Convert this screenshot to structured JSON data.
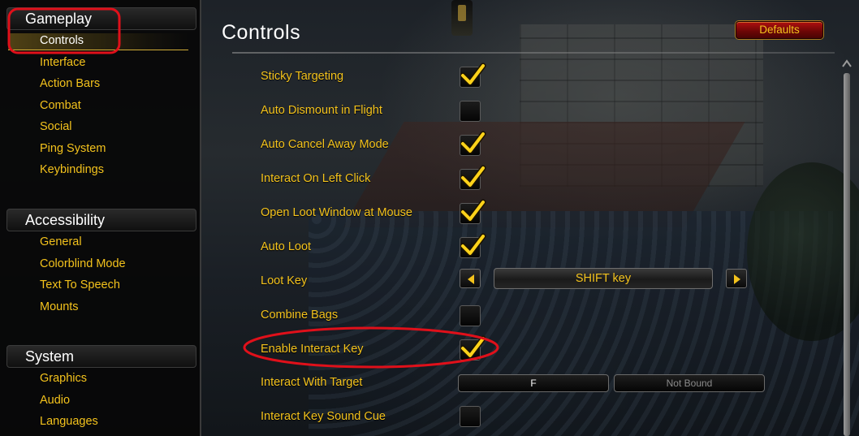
{
  "sidebar": {
    "sections": [
      {
        "title": "Gameplay",
        "items": [
          "Controls",
          "Interface",
          "Action Bars",
          "Combat",
          "Social",
          "Ping System",
          "Keybindings"
        ],
        "selected": "Controls"
      },
      {
        "title": "Accessibility",
        "items": [
          "General",
          "Colorblind Mode",
          "Text To Speech",
          "Mounts"
        ]
      },
      {
        "title": "System",
        "items": [
          "Graphics",
          "Audio",
          "Languages"
        ]
      }
    ]
  },
  "panel": {
    "title": "Controls",
    "defaults_label": "Defaults"
  },
  "settings": [
    {
      "label": "Sticky Targeting",
      "type": "checkbox",
      "checked": true
    },
    {
      "label": "Auto Dismount in Flight",
      "type": "checkbox",
      "checked": false
    },
    {
      "label": "Auto Cancel Away Mode",
      "type": "checkbox",
      "checked": true
    },
    {
      "label": "Interact On Left Click",
      "type": "checkbox",
      "checked": true
    },
    {
      "label": "Open Loot Window at Mouse",
      "type": "checkbox",
      "checked": true
    },
    {
      "label": "Auto Loot",
      "type": "checkbox",
      "checked": true
    },
    {
      "label": "Loot Key",
      "type": "dropdown",
      "value": "SHIFT key"
    },
    {
      "label": "Combine Bags",
      "type": "checkbox",
      "checked": false
    },
    {
      "label": "Enable Interact Key",
      "type": "checkbox",
      "checked": true
    },
    {
      "label": "Interact With Target",
      "type": "keybind",
      "binding_primary": "F",
      "binding_secondary": "Not Bound"
    },
    {
      "label": "Interact Key Sound Cue",
      "type": "checkbox",
      "checked": false
    }
  ],
  "colors": {
    "label_gold": "#f3c21c",
    "annotation_red": "#e0101a",
    "defaults_red": "#8a0a0a"
  }
}
